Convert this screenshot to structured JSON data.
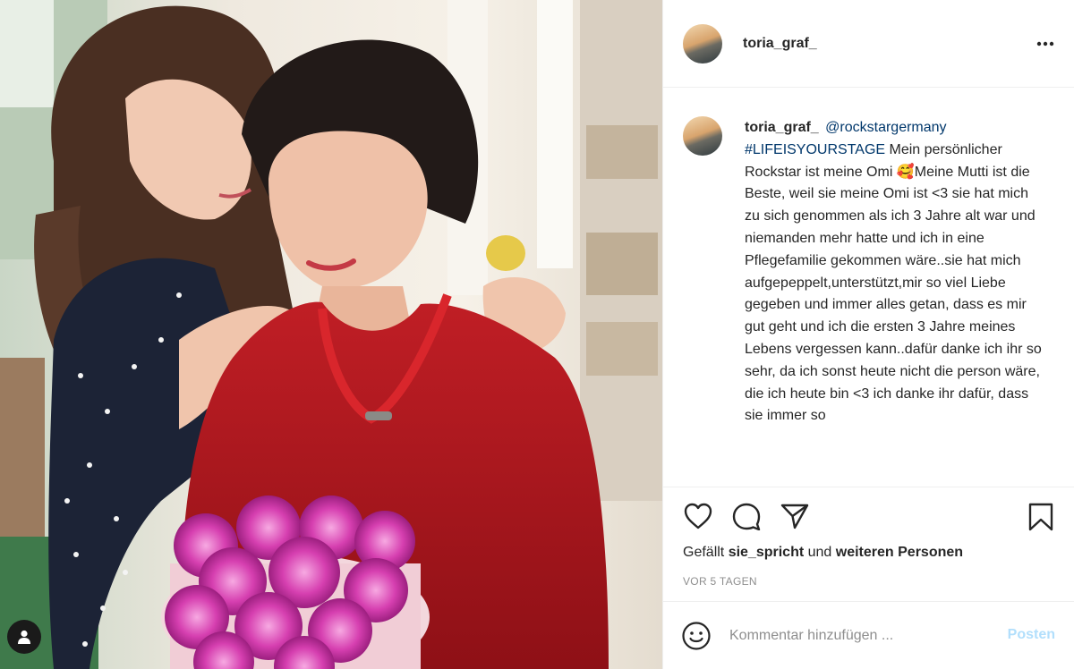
{
  "post": {
    "username": "toria_graf_",
    "mention": "@rockstargermany",
    "hashtag": "#LIFEISYOURSTAGE",
    "caption_body": " Mein persönlicher Rockstar ist meine Omi 🥰Meine Mutti ist die Beste, weil sie meine Omi ist <3 sie hat mich zu sich genommen als ich 3 Jahre alt war und niemanden mehr hatte und ich in eine Pflegefamilie gekommen wäre..sie hat mich aufgepeppelt,unterstützt,mir so viel Liebe gegeben und immer alles getan, dass es mir gut geht und ich die ersten 3 Jahre meines Lebens vergessen kann..dafür danke ich ihr so sehr, da ich sonst heute nicht die person wäre, die ich heute bin <3 ich danke ihr dafür, dass sie immer so"
  },
  "likes": {
    "prefix": "Gefällt ",
    "user": "sie_spricht",
    "middle": " und ",
    "rest": "weiteren Personen"
  },
  "timestamp": "VOR 5 TAGEN",
  "comment": {
    "placeholder": "Kommentar hinzufügen ...",
    "post_label": "Posten"
  },
  "icons": {
    "more": "more-options-icon",
    "like": "heart-icon",
    "comment": "comment-icon",
    "share": "share-icon",
    "save": "bookmark-icon",
    "emoji": "emoji-icon",
    "tag": "user-tag-icon"
  },
  "colors": {
    "link": "#00376b",
    "post_button": "#b2dffc",
    "muted": "#8e8e8e"
  }
}
